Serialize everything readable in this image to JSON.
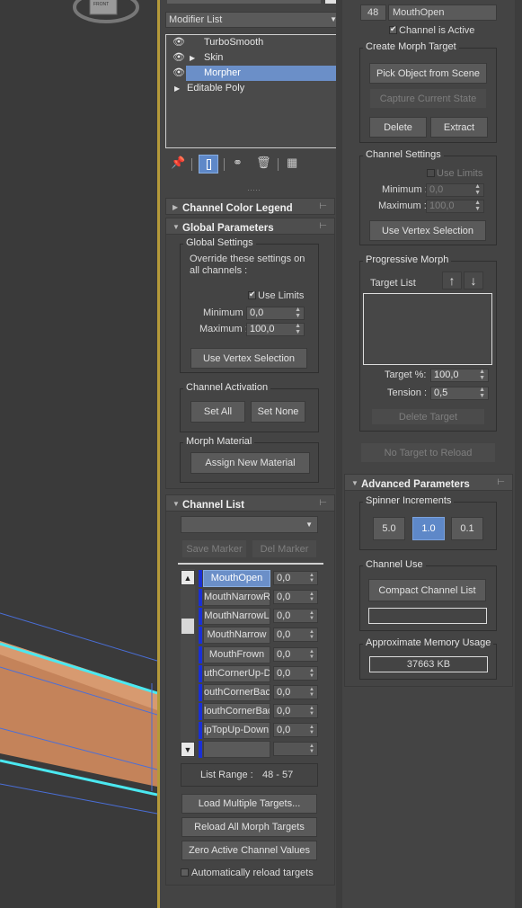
{
  "colors": {
    "panel": "#444444",
    "accent": "#5e88c8",
    "channel_marker": "#1a2fd6",
    "viewport_object": "#c4835a",
    "viewport_outline": "#4be8f0"
  },
  "modifier_panel": {
    "modifier_list_label": "Modifier List",
    "stack": [
      {
        "name": "TurboSmooth",
        "eye": true,
        "expand": false,
        "selected": false
      },
      {
        "name": "Skin",
        "eye": true,
        "expand": true,
        "selected": false
      },
      {
        "name": "Morpher",
        "eye": true,
        "expand": false,
        "selected": true
      },
      {
        "name": "Editable Poly",
        "eye": false,
        "expand": true,
        "selected": false
      }
    ],
    "toolbar_icons": [
      "pin-stack-icon",
      "show-end-result-icon",
      "make-unique-icon",
      "remove-modifier-icon",
      "configure-sets-icon"
    ]
  },
  "channel_color_legend": {
    "title": "Channel Color Legend"
  },
  "global_parameters": {
    "title": "Global Parameters",
    "global_settings": {
      "label": "Global Settings",
      "override_text_1": "Override these settings on",
      "override_text_2": "all channels :",
      "use_limits_label": "Use Limits",
      "use_limits_checked": true,
      "minimum_label": "Minimum :",
      "minimum_value": "0,0",
      "maximum_label": "Maximum :",
      "maximum_value": "100,0",
      "use_vertex_selection": "Use Vertex Selection"
    },
    "channel_activation": {
      "label": "Channel Activation",
      "set_all": "Set All",
      "set_none": "Set None"
    },
    "morph_material": {
      "label": "Morph Material",
      "assign_new_material": "Assign New Material"
    }
  },
  "channel_list": {
    "title": "Channel List",
    "save_marker": "Save Marker",
    "del_marker": "Del Marker",
    "channels": [
      {
        "name": "MouthOpen",
        "value": "0,0",
        "selected": true
      },
      {
        "name": "MouthNarrowR",
        "value": "0,0",
        "selected": false
      },
      {
        "name": "MouthNarrowL",
        "value": "0,0",
        "selected": false
      },
      {
        "name": "MouthNarrow",
        "value": "0,0",
        "selected": false
      },
      {
        "name": "MouthFrown",
        "value": "0,0",
        "selected": false
      },
      {
        "name": "uthCornerUp-Do",
        "value": "0,0",
        "selected": false
      },
      {
        "name": "outhCornerBack",
        "value": "0,0",
        "selected": false
      },
      {
        "name": "louthCornerBac",
        "value": "0,0",
        "selected": false
      },
      {
        "name": "ipTopUp-DownF",
        "value": "0,0",
        "selected": false
      }
    ],
    "list_range_label": "List Range :",
    "list_range_value": "48 - 57",
    "load_multiple_targets": "Load Multiple Targets...",
    "reload_all_morph_targets": "Reload All Morph Targets",
    "zero_active_channel_values": "Zero Active Channel Values",
    "auto_reload_label": "Automatically reload targets",
    "auto_reload_checked": false
  },
  "channel_parameters": {
    "channel_number": "48",
    "channel_name": "MouthOpen",
    "channel_is_active_label": "Channel is Active",
    "channel_is_active": true,
    "create_morph_target": {
      "label": "Create Morph Target",
      "pick_object": "Pick Object from Scene",
      "capture_current_state": "Capture Current State",
      "delete": "Delete",
      "extract": "Extract"
    },
    "channel_settings": {
      "label": "Channel Settings",
      "use_limits_label": "Use Limits",
      "minimum_label": "Minimum :",
      "minimum_value": "0,0",
      "maximum_label": "Maximum :",
      "maximum_value": "100,0",
      "use_vertex_selection": "Use Vertex Selection"
    },
    "progressive_morph": {
      "label": "Progressive Morph",
      "target_list_label": "Target List",
      "target_pct_label": "Target %:",
      "target_pct_value": "100,0",
      "tension_label": "Tension :",
      "tension_value": "0,5",
      "delete_target": "Delete Target"
    },
    "no_target_to_reload": "No Target to Reload"
  },
  "advanced_parameters": {
    "title": "Advanced Parameters",
    "spinner_increments": {
      "label": "Spinner Increments",
      "options": [
        "5.0",
        "1.0",
        "0.1"
      ],
      "selected": "1.0"
    },
    "channel_use": {
      "label": "Channel Use",
      "compact_channel_list": "Compact Channel List"
    },
    "memory": {
      "label": "Approximate Memory Usage",
      "value": "37663 KB"
    }
  },
  "viewport": {
    "viewcube_label": "FRONT"
  }
}
